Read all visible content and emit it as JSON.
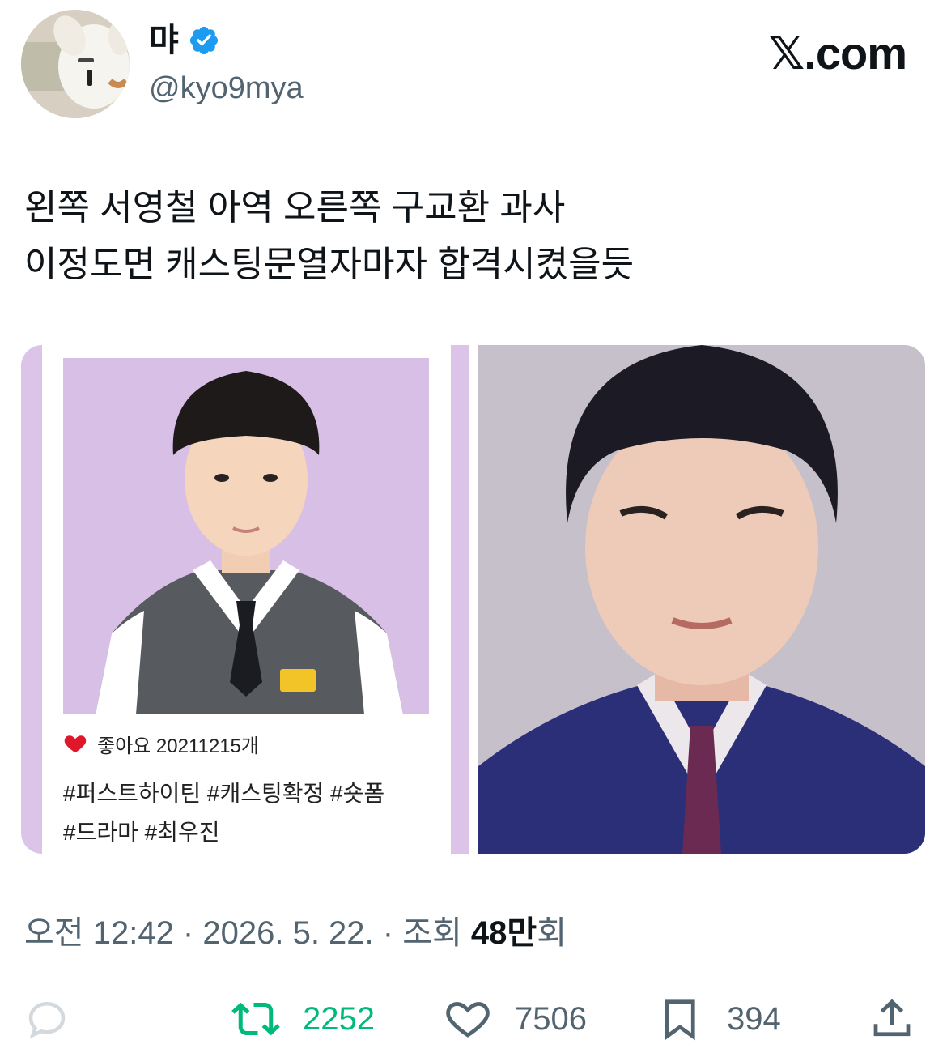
{
  "user": {
    "display_name": "먀",
    "handle": "@kyo9mya",
    "verified": true
  },
  "brand": "𝕏.com",
  "tweet": {
    "text": "왼쪽 서영철 아역  오른쪽 구교환 과사\n이정도면 캐스팅문열자마자 합격시켰을듯"
  },
  "media": {
    "left_card": {
      "likes_label": "좋아요 20211215개",
      "tags": "#퍼스트하이틴 #캐스팅확정 #숏폼\n#드라마 #최우진",
      "background": "#d8bfe6"
    }
  },
  "meta": {
    "time": "오전 12:42",
    "sep1": " · ",
    "date": "2026. 5. 22.",
    "sep2": " · ",
    "views_label": "조회 ",
    "views_count": "48만",
    "views_suffix": "회"
  },
  "actions": {
    "reply_icon": "reply-bubble-icon",
    "retweet_count": "2252",
    "like_count": "7506",
    "bookmark_count": "394",
    "retweet_color": "#00ba7c"
  },
  "colors": {
    "verified": "#1d9bf0",
    "secondary_text": "#536471",
    "retweet_green": "#00ba7c",
    "heart_red": "#e0162b"
  }
}
